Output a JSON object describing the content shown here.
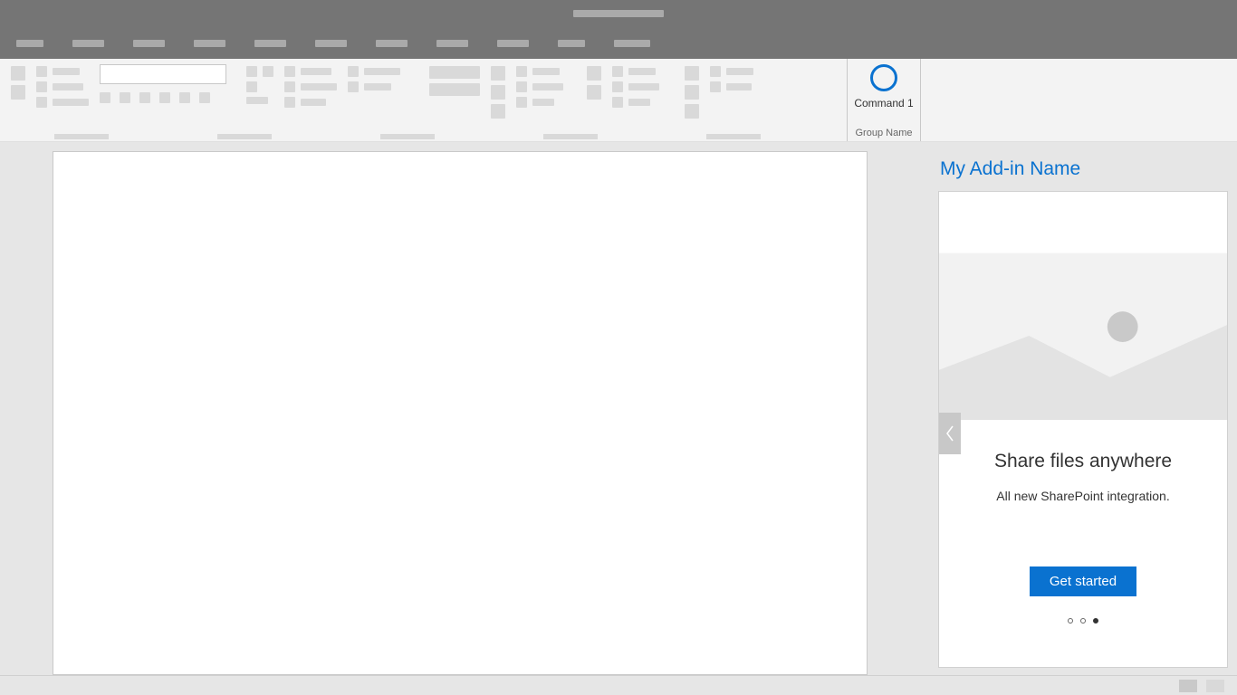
{
  "ribbon": {
    "command1": {
      "label": "Command 1",
      "group": "Group Name"
    }
  },
  "taskpane": {
    "title": "My Add-in Name",
    "card": {
      "heading": "Share files anywhere",
      "subheading": "All new SharePoint integration.",
      "cta": "Get started",
      "activeDot": 2,
      "dotCount": 3
    }
  }
}
